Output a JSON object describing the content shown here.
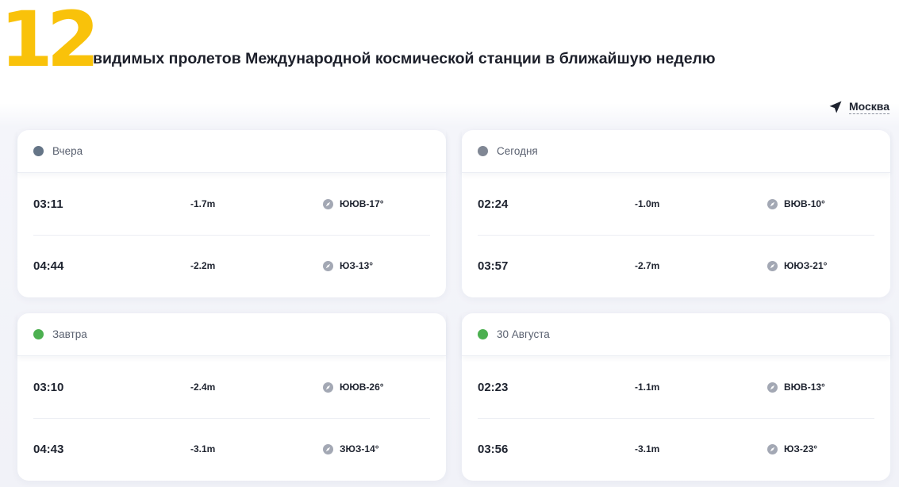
{
  "header": {
    "count": "12",
    "headline": "видимых пролетов Международной космической станции в ближайшую неделю"
  },
  "location": {
    "label": "Москва",
    "icon": "location-arrow-icon"
  },
  "colors": {
    "accent": "#f9c20a",
    "past": "#657587",
    "today": "#808794",
    "future": "#4cb050"
  },
  "cards": [
    {
      "title": "Вчера",
      "status_color": "#657587",
      "rows": [
        {
          "time": "03:11",
          "magnitude": "-1.7m",
          "direction": "ЮЮВ-17°"
        },
        {
          "time": "04:44",
          "magnitude": "-2.2m",
          "direction": "ЮЗ-13°"
        }
      ]
    },
    {
      "title": "Сегодня",
      "status_color": "#808794",
      "rows": [
        {
          "time": "02:24",
          "magnitude": "-1.0m",
          "direction": "ВЮВ-10°"
        },
        {
          "time": "03:57",
          "magnitude": "-2.7m",
          "direction": "ЮЮЗ-21°"
        }
      ]
    },
    {
      "title": "Завтра",
      "status_color": "#4cb050",
      "rows": [
        {
          "time": "03:10",
          "magnitude": "-2.4m",
          "direction": "ЮЮВ-26°"
        },
        {
          "time": "04:43",
          "magnitude": "-3.1m",
          "direction": "ЗЮЗ-14°"
        }
      ]
    },
    {
      "title": "30 Августа",
      "status_color": "#4cb050",
      "rows": [
        {
          "time": "02:23",
          "magnitude": "-1.1m",
          "direction": "ВЮВ-13°"
        },
        {
          "time": "03:56",
          "magnitude": "-3.1m",
          "direction": "ЮЗ-23°"
        }
      ]
    }
  ]
}
